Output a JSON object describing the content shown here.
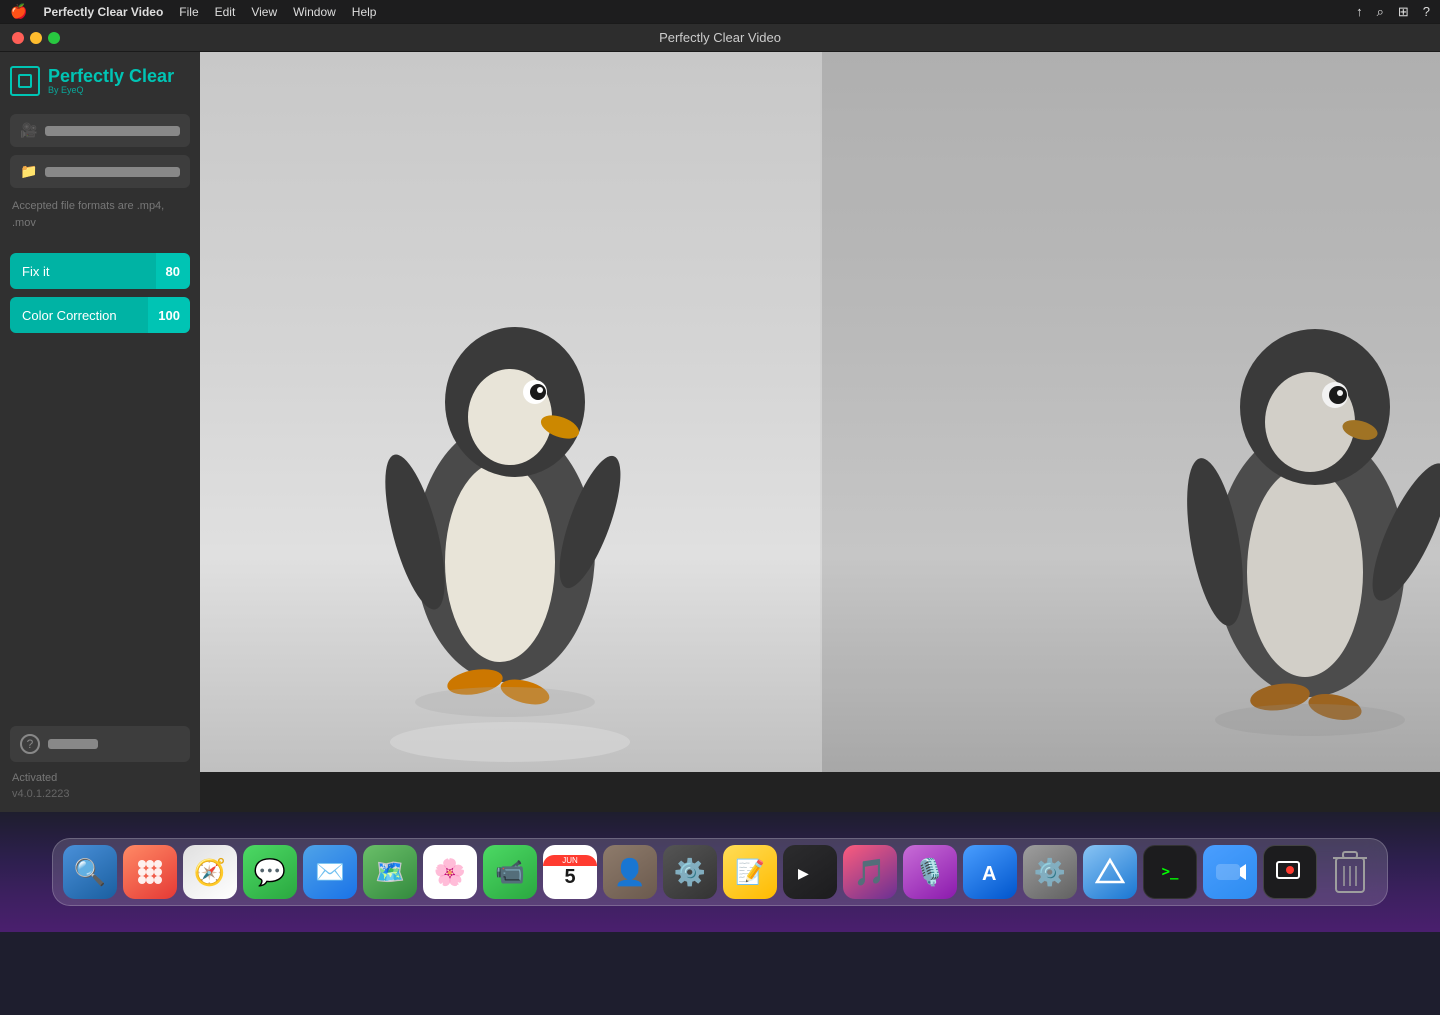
{
  "menubar": {
    "apple": "🍎",
    "app_name": "Perfectly Clear Video",
    "menu_items": [
      "File",
      "Edit",
      "View",
      "Window",
      "Help"
    ],
    "right_icons": [
      "↑",
      "🔍",
      "▦",
      "?"
    ]
  },
  "titlebar": {
    "title": "Perfectly Clear Video"
  },
  "sidebar": {
    "logo_text": "Perfectly Clear",
    "logo_subtext": "By EyeQ",
    "input_button_icon": "🎥",
    "output_button_icon": "📁",
    "file_format_text": "Accepted file formats are .mp4, .mov",
    "fix_it_label": "Fix it",
    "fix_it_value": "80",
    "color_correction_label": "Color Correction",
    "color_correction_value": "100",
    "help_icon": "?",
    "status": "Activated",
    "version": "v4.0.1.2223"
  },
  "dock": {
    "items": [
      {
        "name": "finder",
        "icon": "🔍",
        "color": "#4a90d9",
        "bg": "#4a90d9"
      },
      {
        "name": "launchpad",
        "icon": "⊞",
        "color": "#ff6b6b",
        "bg": "#ff6b6b"
      },
      {
        "name": "safari",
        "icon": "🧭",
        "color": "#0066cc",
        "bg": "#fff"
      },
      {
        "name": "messages",
        "icon": "💬",
        "color": "#4cd964",
        "bg": "#4cd964"
      },
      {
        "name": "mail",
        "icon": "✉",
        "color": "#4a9eff",
        "bg": "#fff"
      },
      {
        "name": "maps",
        "icon": "🗺",
        "color": "#4cd964",
        "bg": "#fff"
      },
      {
        "name": "photos",
        "icon": "🌸",
        "color": "#ff9500",
        "bg": "#fff"
      },
      {
        "name": "facetime",
        "icon": "📹",
        "color": "#4cd964",
        "bg": "#4cd964"
      },
      {
        "name": "calendar",
        "icon": "📅",
        "color": "#ff3b30",
        "bg": "#fff"
      },
      {
        "name": "contacts",
        "icon": "👤",
        "color": "#8e8e93",
        "bg": "#fff"
      },
      {
        "name": "control-center",
        "icon": "⚙",
        "color": "#aaa",
        "bg": "#3d3d3d"
      },
      {
        "name": "notes",
        "icon": "📝",
        "color": "#ffcc00",
        "bg": "#ffcc00"
      },
      {
        "name": "appletv",
        "icon": "▶",
        "color": "#1c1c1e",
        "bg": "#1c1c1e"
      },
      {
        "name": "music",
        "icon": "🎵",
        "color": "#fc3c44",
        "bg": "#fc3c44"
      },
      {
        "name": "podcasts",
        "icon": "🎙",
        "color": "#b160ee",
        "bg": "#b160ee"
      },
      {
        "name": "appstore",
        "icon": "A",
        "color": "#0066cc",
        "bg": "#0066cc"
      },
      {
        "name": "system-preferences",
        "icon": "⚙",
        "color": "#8e8e93",
        "bg": "#8e8e93"
      },
      {
        "name": "altimeter",
        "icon": "△",
        "color": "#4a9eff",
        "bg": "#4a9eff"
      },
      {
        "name": "terminal",
        "icon": ">_",
        "color": "#fff",
        "bg": "#1c1c1e"
      },
      {
        "name": "zoom",
        "icon": "Z",
        "color": "#2d8cf0",
        "bg": "#2d8cf0"
      },
      {
        "name": "screenrecord",
        "icon": "◉",
        "color": "#fff",
        "bg": "#1c1c1e"
      },
      {
        "name": "trash",
        "icon": "🗑",
        "color": "#8e8e93",
        "bg": "#8e8e93"
      }
    ]
  }
}
